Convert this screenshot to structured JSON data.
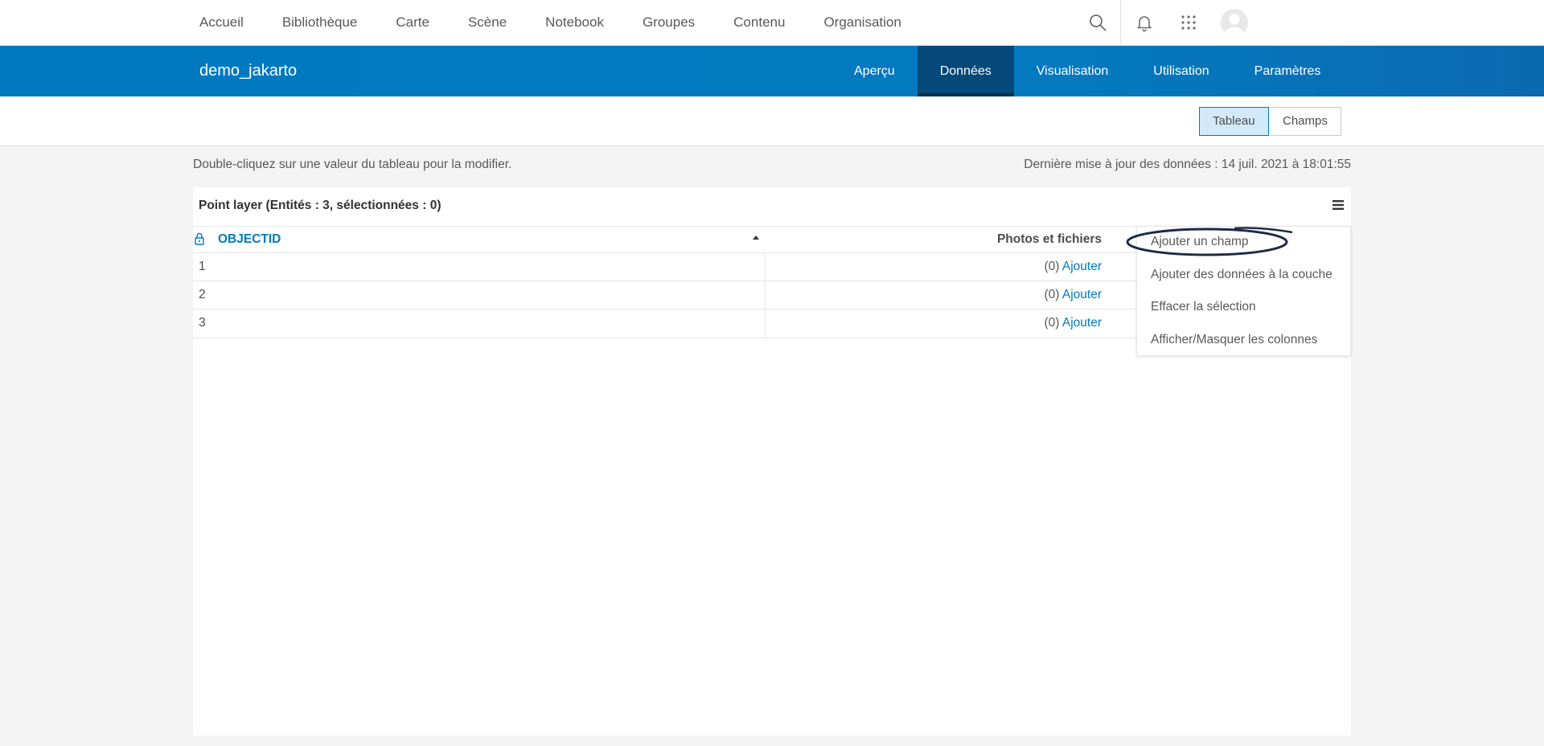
{
  "topnav": {
    "links": [
      "Accueil",
      "Bibliothèque",
      "Carte",
      "Scène",
      "Notebook",
      "Groupes",
      "Contenu",
      "Organisation"
    ],
    "icons": [
      "search-icon",
      "bell-icon",
      "apps-grid-icon",
      "avatar"
    ]
  },
  "item": {
    "title": "demo_jakarto",
    "tabs": [
      "Aperçu",
      "Données",
      "Visualisation",
      "Utilisation",
      "Paramètres"
    ],
    "active_tab": "Données"
  },
  "view_toggle": {
    "table": "Tableau",
    "fields": "Champs",
    "active": "Tableau"
  },
  "hint": "Double-cliquez sur une valeur du tableau pour la modifier.",
  "updated": "Dernière mise à jour des données : 14 juil. 2021 à 18:01:55",
  "table": {
    "title": "Point layer (Entités : 3, sélectionnées : 0)",
    "columns": [
      "OBJECTID",
      "Photos et fichiers"
    ],
    "rows": [
      {
        "id": "1",
        "count": "(0)",
        "action": "Ajouter"
      },
      {
        "id": "2",
        "count": "(0)",
        "action": "Ajouter"
      },
      {
        "id": "3",
        "count": "(0)",
        "action": "Ajouter"
      }
    ]
  },
  "menu": {
    "items": [
      "Ajouter un champ",
      "Ajouter des données à la couche",
      "Effacer la sélection",
      "Afficher/Masquer les colonnes"
    ]
  },
  "colors": {
    "brand": "#0079c1",
    "active_tab": "#05487a",
    "link": "#0079c1",
    "highlight": "#1e2a4a"
  }
}
